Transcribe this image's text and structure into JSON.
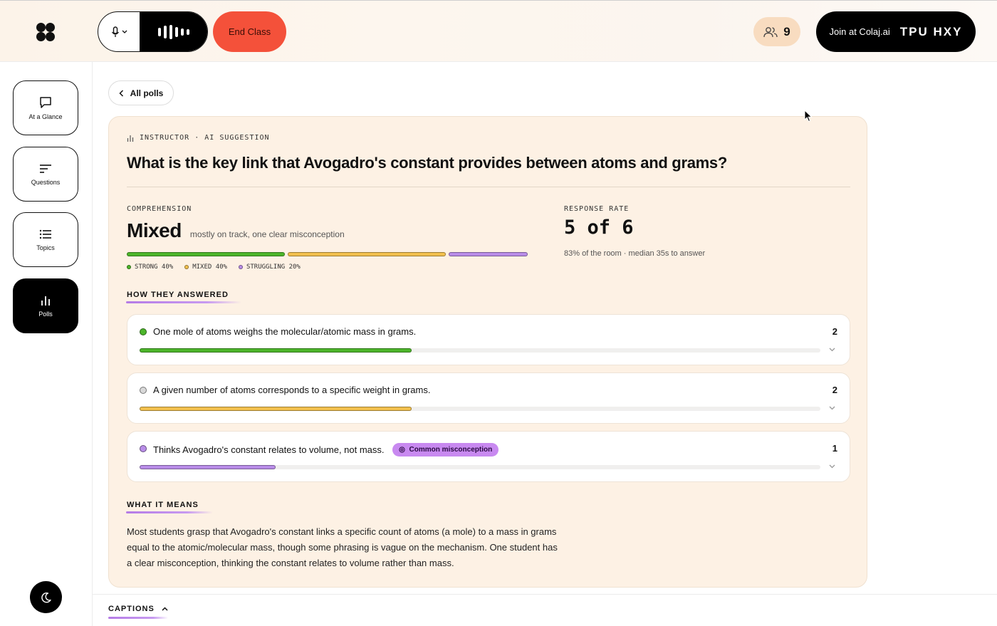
{
  "header": {
    "logo_icon": "colaj-logo",
    "mic_icon": "microphone-icon",
    "end_class_label": "End Class",
    "participants_count": "9",
    "join_label": "Join at Colaj.ai",
    "join_code": "TPU HXY"
  },
  "sidebar": {
    "items": [
      {
        "label": "At a Glance",
        "icon": "chat-bubble-icon"
      },
      {
        "label": "Questions",
        "icon": "lines-icon"
      },
      {
        "label": "Topics",
        "icon": "list-icon"
      },
      {
        "label": "Polls",
        "icon": "bar-chart-icon"
      }
    ],
    "active": "Polls"
  },
  "back_label": "All polls",
  "poll": {
    "eyebrow": "INSTRUCTOR · AI SUGGESTION",
    "question": "What is the key link that Avogadro's constant provides between atoms and grams?",
    "comprehension": {
      "label": "COMPREHENSION",
      "value": "Mixed",
      "summary": "mostly on track, one clear misconception",
      "segments": [
        {
          "label": "STRONG 40%",
          "fraction": 0.4,
          "color": "#4cb52a"
        },
        {
          "label": "MIXED 40%",
          "fraction": 0.4,
          "color": "#f2c04e"
        },
        {
          "label": "STRUGGLING 20%",
          "fraction": 0.2,
          "color": "#b98de8"
        }
      ]
    },
    "response": {
      "label": "RESPONSE RATE",
      "value": "5 of 6",
      "detail": "83% of the room · median 35s to answer"
    },
    "answers_title": "HOW THEY ANSWERED",
    "answers": [
      {
        "text": "One mole of atoms weighs the molecular/atomic mass in grams.",
        "count": "2",
        "fraction": 0.4,
        "color": "#4cb52a",
        "dot": "#4cb52a",
        "badge": ""
      },
      {
        "text": "A given number of atoms corresponds to a specific weight in grams.",
        "count": "2",
        "fraction": 0.4,
        "color": "#f2c04e",
        "dot": "#d8d8d8",
        "badge": ""
      },
      {
        "text": "Thinks Avogadro's constant relates to volume, not mass.",
        "count": "1",
        "fraction": 0.2,
        "color": "#b98de8",
        "dot": "#b98de8",
        "badge": "Common misconception"
      }
    ],
    "meaning_title": "WHAT IT MEANS",
    "meaning_text": "Most students grasp that Avogadro's constant links a specific count of atoms (a mole) to a mass in grams equal to the atomic/molecular mass, though some phrasing is vague on the mechanism. One student has a clear misconception, thinking the constant relates to volume rather than mass."
  },
  "captions_label": "CAPTIONS"
}
